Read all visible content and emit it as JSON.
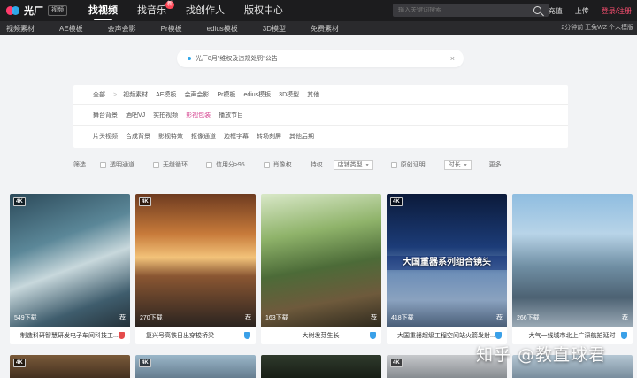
{
  "header": {
    "logo_name": "光厂",
    "logo_tag": "视频",
    "nav": [
      {
        "label": "找视频",
        "active": true
      },
      {
        "label": "找音乐",
        "badge": "新"
      },
      {
        "label": "找创作人"
      },
      {
        "label": "版权中心"
      }
    ],
    "search_placeholder": "输入关键词搜索",
    "right": {
      "recharge": "充值",
      "upload": "上传",
      "login": "登录/注册"
    }
  },
  "subnav": {
    "items": [
      "视频素材",
      "AE模板",
      "会声会影",
      "Pr模板",
      "edius模板",
      "3D模型",
      "免费素材"
    ],
    "right_text": "2分钟前 王兔WZ 个人模版"
  },
  "notice": {
    "text": "光厂8月\"维权及违规处罚\"公告",
    "close": "×"
  },
  "filter": {
    "row1": [
      "全部",
      ">",
      "视频素材",
      "AE模板",
      "会声会影",
      "Pr模板",
      "edius模板",
      "3D模型",
      "其他"
    ],
    "row2": [
      "舞台背景",
      "酒吧VJ",
      "实拍视频",
      "影视包装",
      "播放节目"
    ],
    "row2_highlight": "影视包装",
    "row3": [
      "片头视频",
      "合成背景",
      "影视特效",
      "抠像通道",
      "边框字幕",
      "转场刻屏",
      "其他后期"
    ]
  },
  "options": {
    "filter_label": "筛选",
    "checks": [
      "透明通道",
      "无缝循环",
      "信用分≥95",
      "肖像权"
    ],
    "property_label": "特权",
    "sort_select": "店铺类型",
    "original_check": "原创证明",
    "duration_select": "时长",
    "more": "更多"
  },
  "cards": [
    {
      "title": "制造科研智慧研发电子车间科技工...",
      "downloads": "549下载",
      "fav": "荐",
      "shield": "red",
      "hd": "4K",
      "overlay": ""
    },
    {
      "title": "复兴号高铁日出穿梭桥梁",
      "downloads": "270下载",
      "fav": "荐",
      "shield": "blue",
      "hd": "4K",
      "overlay": ""
    },
    {
      "title": "大树发芽生长",
      "downloads": "163下载",
      "fav": "荐",
      "shield": "blue",
      "hd": "",
      "overlay": ""
    },
    {
      "title": "大国重器超级工程空间站火箭发射...",
      "downloads": "418下载",
      "fav": "荐",
      "shield": "blue",
      "hd": "4K",
      "overlay": "大国重器系列组合镜头"
    },
    {
      "title": "大气一线城市北上广深航拍延时",
      "downloads": "266下载",
      "fav": "荐",
      "shield": "blue",
      "hd": "",
      "overlay": ""
    }
  ],
  "bottom_cards": [
    {
      "hd": "4K"
    },
    {
      "hd": "4K"
    },
    {
      "hd": ""
    },
    {
      "hd": "4K"
    },
    {
      "hd": ""
    }
  ],
  "watermark": "知乎 @教直球君",
  "colors": {
    "accent_pink": "#d43f8d",
    "login_pink": "#ff4f72",
    "topbar": "#1c1c1e"
  }
}
